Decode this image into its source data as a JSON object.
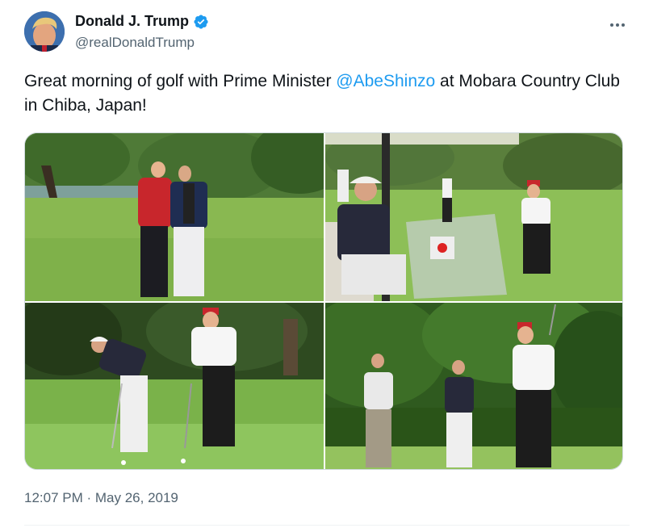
{
  "author": {
    "display_name": "Donald J. Trump",
    "handle": "@realDonaldTrump",
    "verified_icon": "verified-badge-icon",
    "verified_color": "#1d9bf0"
  },
  "tweet": {
    "text_before": "Great morning of golf with Prime Minister ",
    "mention": "@AbeShinzo",
    "text_after": " at Mobara Country Club in Chiba, Japan!",
    "timestamp": "12:07 PM · May 26, 2019"
  },
  "colors": {
    "link": "#1d9bf0",
    "secondary_text": "#536471",
    "primary_text": "#0f1419"
  },
  "media": {
    "photo_count": 4
  }
}
